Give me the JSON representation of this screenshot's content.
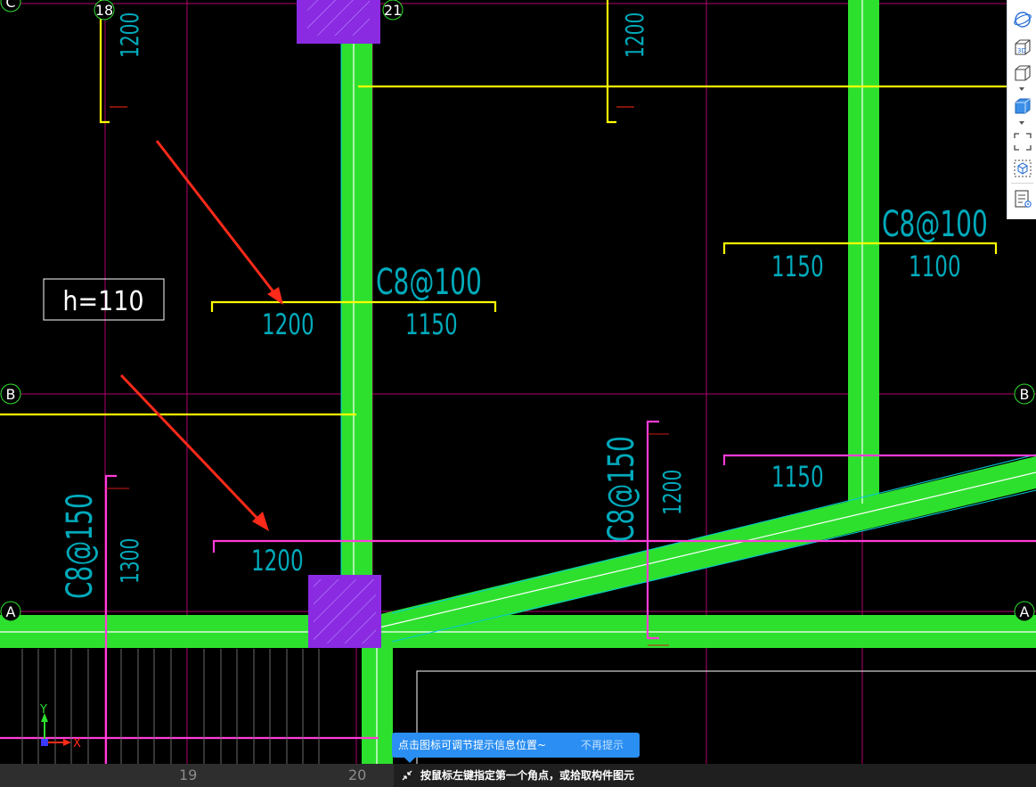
{
  "drawing": {
    "grid_labels": {
      "c": "C",
      "b_left": "B",
      "b_right": "B",
      "a_left": "A",
      "a_right": "A",
      "n18": "18",
      "n21": "21",
      "n19": "19",
      "n20": "20"
    },
    "slab_note": "h=110",
    "rebar_labels": {
      "top_left_span": "1200",
      "top_mid_span": "1200",
      "mid_left_spec": "C8@100",
      "mid_left_len1": "1200",
      "mid_left_len2": "1150",
      "right_spec": "C8@100",
      "right_len1": "1150",
      "right_len2": "1100",
      "lower_spec": "C8@150",
      "lower_len1": "1200",
      "lower_right_len": "1150",
      "left_spec": "C8@150",
      "left_len": "1300",
      "bottom_len": "1200"
    },
    "ucs": {
      "x": "X",
      "y": "Y"
    },
    "colors": {
      "beam": "#2ee02e",
      "grid_line": "#c0007a",
      "rebar_yellow": "#ffff00",
      "rebar_magenta": "#ff3cd8",
      "dim_text": "#00aabb",
      "column": "#8a2be2",
      "arrow": "#ff2a1a"
    }
  },
  "toolbar": {
    "items": [
      {
        "icon": "orbit-icon"
      },
      {
        "icon": "3d-view-icon",
        "text": "3D"
      },
      {
        "icon": "box-view-icon"
      },
      {
        "icon": "box-filled-icon"
      },
      {
        "icon": "fullscreen-icon"
      },
      {
        "icon": "component-icon"
      },
      {
        "icon": "list-settings-icon"
      }
    ]
  },
  "hint": {
    "message": "点击图标可调节提示信息位置~",
    "dismiss": "不再提示"
  },
  "status": {
    "prompt": "按鼠标左键指定第一个角点，或拾取构件图元"
  }
}
